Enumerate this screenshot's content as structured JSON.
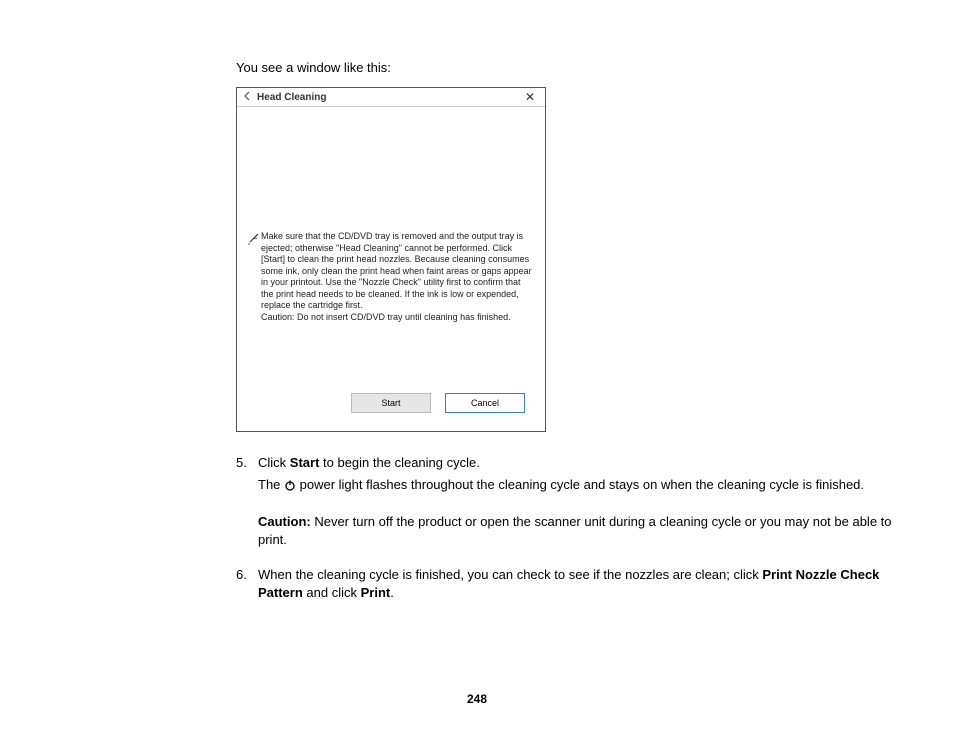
{
  "intro": "You see a window like this:",
  "dialog": {
    "title": "Head Cleaning",
    "message": "Make sure that the CD/DVD tray is removed and the output tray is ejected; otherwise \"Head Cleaning\" cannot be performed. Click [Start] to clean the print head nozzles. Because cleaning consumes some ink, only clean the print head when faint areas or gaps appear in your printout. Use the \"Nozzle Check\" utility first to confirm that the print head needs to be cleaned. If the ink is low or expended, replace the cartridge first.",
    "caution": "Caution: Do not insert CD/DVD tray until cleaning has finished.",
    "start_label": "Start",
    "cancel_label": "Cancel"
  },
  "steps": {
    "s5": {
      "num": "5.",
      "line1_a": "Click ",
      "line1_b_bold": "Start",
      "line1_c": " to begin the cleaning cycle.",
      "line2_a": "The ",
      "line2_b": " power light flashes throughout the cleaning cycle and stays on when the cleaning cycle is finished.",
      "caution_label": "Caution:",
      "caution_text": " Never turn off the product or open the scanner unit during a cleaning cycle or you may not be able to print."
    },
    "s6": {
      "num": "6.",
      "a": "When the cleaning cycle is finished, you can check to see if the nozzles are clean; click ",
      "b_bold": "Print Nozzle Check Pattern",
      "c": " and click ",
      "d_bold": "Print",
      "e": "."
    }
  },
  "page_number": "248"
}
